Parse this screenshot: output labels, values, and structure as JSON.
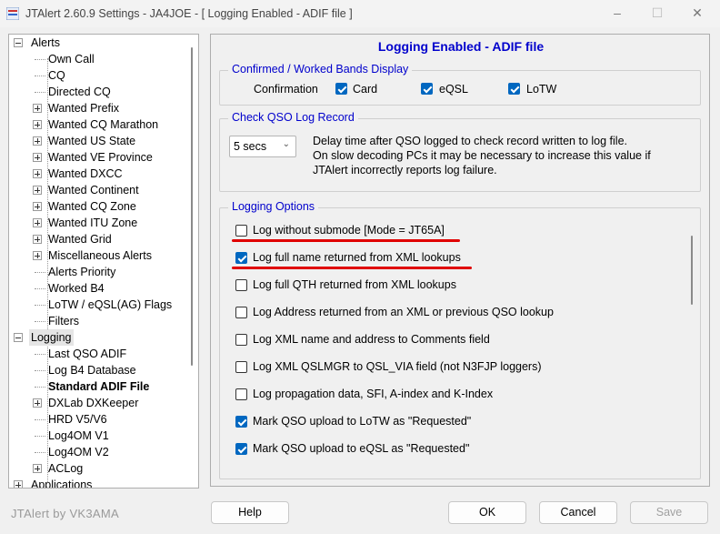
{
  "window": {
    "title": "JTAlert 2.60.9 Settings  -  JA4JOE  -  [ Logging Enabled - ADIF file ]",
    "controls": {
      "minimize": "–",
      "maximize": "☐",
      "close": "✕"
    }
  },
  "tree": {
    "items": [
      {
        "label": "Alerts",
        "bold": false
      },
      {
        "label": "Own Call"
      },
      {
        "label": "CQ"
      },
      {
        "label": "Directed CQ"
      },
      {
        "label": "Wanted Prefix"
      },
      {
        "label": "Wanted CQ Marathon"
      },
      {
        "label": "Wanted US State"
      },
      {
        "label": "Wanted VE Province"
      },
      {
        "label": "Wanted DXCC"
      },
      {
        "label": "Wanted Continent"
      },
      {
        "label": "Wanted CQ Zone"
      },
      {
        "label": "Wanted ITU Zone"
      },
      {
        "label": "Wanted Grid"
      },
      {
        "label": "Miscellaneous Alerts"
      },
      {
        "label": "Alerts Priority"
      },
      {
        "label": "Worked B4"
      },
      {
        "label": "LoTW / eQSL(AG) Flags"
      },
      {
        "label": "Filters"
      },
      {
        "label": "Logging"
      },
      {
        "label": "Last QSO ADIF"
      },
      {
        "label": "Log B4 Database"
      },
      {
        "label": "Standard ADIF File",
        "selected": true
      },
      {
        "label": "DXLab DXKeeper"
      },
      {
        "label": "HRD V5/V6"
      },
      {
        "label": "Log4OM V1"
      },
      {
        "label": "Log4OM V2"
      },
      {
        "label": "ACLog"
      },
      {
        "label": "Applications"
      }
    ]
  },
  "panel": {
    "title": "Logging Enabled - ADIF file",
    "bands_group": {
      "label": "Confirmed / Worked Bands Display",
      "row_label": "Confirmation",
      "options": [
        {
          "label": "Card",
          "checked": true
        },
        {
          "label": "eQSL",
          "checked": true
        },
        {
          "label": "LoTW",
          "checked": true
        }
      ]
    },
    "check_group": {
      "label": "Check QSO Log Record",
      "delay_value": "5 secs",
      "description": [
        "Delay time after QSO logged to check record written to log file.",
        "On slow decoding PCs it may be necessary to increase this value if",
        "JTAlert incorrectly reports log failure."
      ]
    },
    "options_group": {
      "label": "Logging Options",
      "options": [
        {
          "label": "Log without submode [Mode = JT65A]",
          "checked": false
        },
        {
          "label": "Log full name returned from XML lookups",
          "checked": true
        },
        {
          "label": "Log full QTH returned from XML lookups",
          "checked": false
        },
        {
          "label": "Log Address returned from an XML or previous QSO lookup",
          "checked": false
        },
        {
          "label": "Log XML name and address to Comments field",
          "checked": false
        },
        {
          "label": "Log XML QSLMGR to QSL_VIA field (not N3FJP loggers)",
          "checked": false
        },
        {
          "label": "Log propagation data, SFI, A-index and K-Index",
          "checked": false
        },
        {
          "label": "Mark QSO upload to LoTW as \"Requested\"",
          "checked": true
        },
        {
          "label": "Mark QSO upload to eQSL as \"Requested\"",
          "checked": true
        }
      ]
    }
  },
  "footer": {
    "brand": "JTAlert by VK3AMA",
    "help": "Help",
    "ok": "OK",
    "cancel": "Cancel",
    "save": "Save"
  },
  "colors": {
    "accent": "#0000cc",
    "checkbox": "#0067c0",
    "annotation": "#e00000"
  }
}
